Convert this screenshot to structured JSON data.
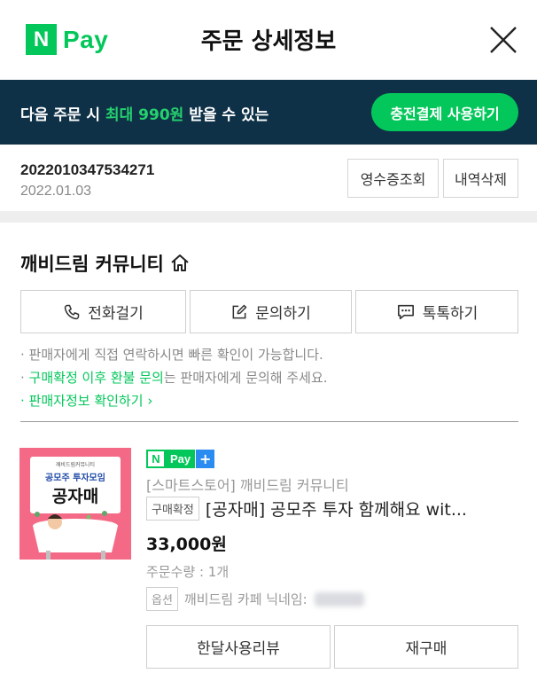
{
  "header": {
    "logo_n": "N",
    "logo_pay": "Pay",
    "title": "주문 상세정보"
  },
  "banner": {
    "text_before": "다음 주문 시 ",
    "text_highlight": "최대 990원",
    "text_after": " 받을 수 있는",
    "button_label": "충전결제 사용하기",
    "highlight_color": "#25d16e",
    "bg_color": "#0e3147"
  },
  "order": {
    "number": "2022010347534271",
    "date": "2022.01.03",
    "receipt_button": "영수증조회",
    "delete_button": "내역삭제"
  },
  "store": {
    "name": "깨비드림 커뮤니티",
    "call_button": "전화걸기",
    "inquiry_button": "문의하기",
    "talk_button": "톡톡하기",
    "note1": "판매자에게 직접 연락하시면 빠른 확인이 가능합니다.",
    "note2_green": "구매확정 이후 환불 문의",
    "note2_rest": "는 판매자에게 문의해 주세요.",
    "note3_link": "판매자정보 확인하기"
  },
  "product": {
    "thumb_top": "깨비드림커뮤니티",
    "thumb_sub": "공모주 투자모임",
    "thumb_main": "공자매",
    "badge_n": "N",
    "badge_pay": "Pay",
    "badge_plus": "+",
    "store_line": "[스마트스토어] 깨비드림 커뮤니티",
    "status_tag": "구매확정",
    "name": "[공자매] 공모주 투자 함께해요 wit...",
    "price": "33,000원",
    "quantity": "주문수량 : 1개",
    "option_tag": "옵션",
    "option_text": "깨비드림 카페 닉네임:"
  },
  "actions": {
    "review_button": "한달사용리뷰",
    "rebuy_button": "재구매"
  },
  "colors": {
    "accent": "#03c75a"
  }
}
